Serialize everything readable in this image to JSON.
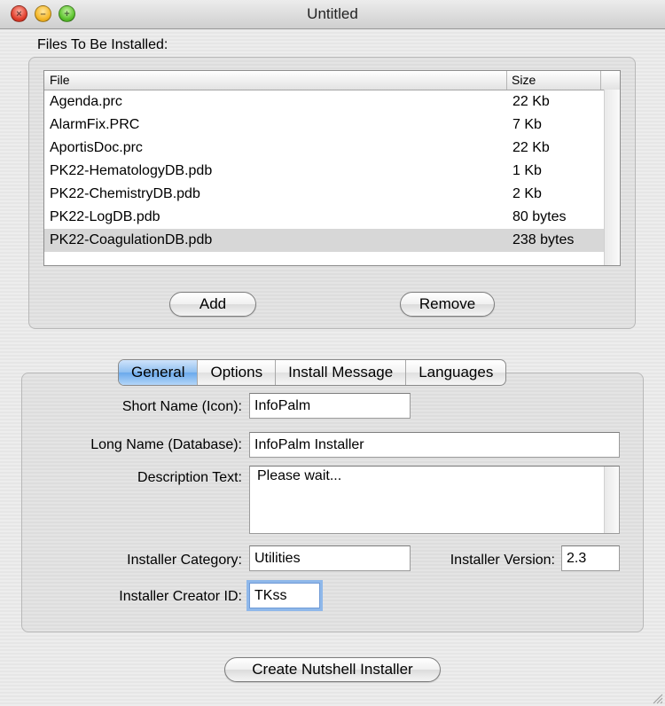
{
  "window": {
    "title": "Untitled"
  },
  "files_section": {
    "label": "Files To Be Installed:",
    "columns": {
      "file": "File",
      "size": "Size"
    },
    "rows": [
      {
        "file": "Agenda.prc",
        "size": "22 Kb",
        "selected": false
      },
      {
        "file": "AlarmFix.PRC",
        "size": "7 Kb",
        "selected": false
      },
      {
        "file": "AportisDoc.prc",
        "size": "22 Kb",
        "selected": false
      },
      {
        "file": "PK22-HematologyDB.pdb",
        "size": "1 Kb",
        "selected": false
      },
      {
        "file": "PK22-ChemistryDB.pdb",
        "size": "2 Kb",
        "selected": false
      },
      {
        "file": "PK22-LogDB.pdb",
        "size": "80 bytes",
        "selected": false
      },
      {
        "file": "PK22-CoagulationDB.pdb",
        "size": "238 bytes",
        "selected": true
      }
    ],
    "add_label": "Add",
    "remove_label": "Remove"
  },
  "tabs": [
    {
      "label": "General",
      "active": true
    },
    {
      "label": "Options",
      "active": false
    },
    {
      "label": "Install Message",
      "active": false
    },
    {
      "label": "Languages",
      "active": false
    }
  ],
  "general": {
    "short_name_label": "Short Name (Icon):",
    "short_name_value": "InfoPalm",
    "long_name_label": "Long Name (Database):",
    "long_name_value": "InfoPalm Installer",
    "description_label": "Description Text:",
    "description_value": "Please wait...",
    "category_label": "Installer Category:",
    "category_value": "Utilities",
    "version_label": "Installer Version:",
    "version_value": "2.3",
    "creator_label": "Installer Creator ID:",
    "creator_value": "TKss"
  },
  "create_button_label": "Create Nutshell Installer"
}
